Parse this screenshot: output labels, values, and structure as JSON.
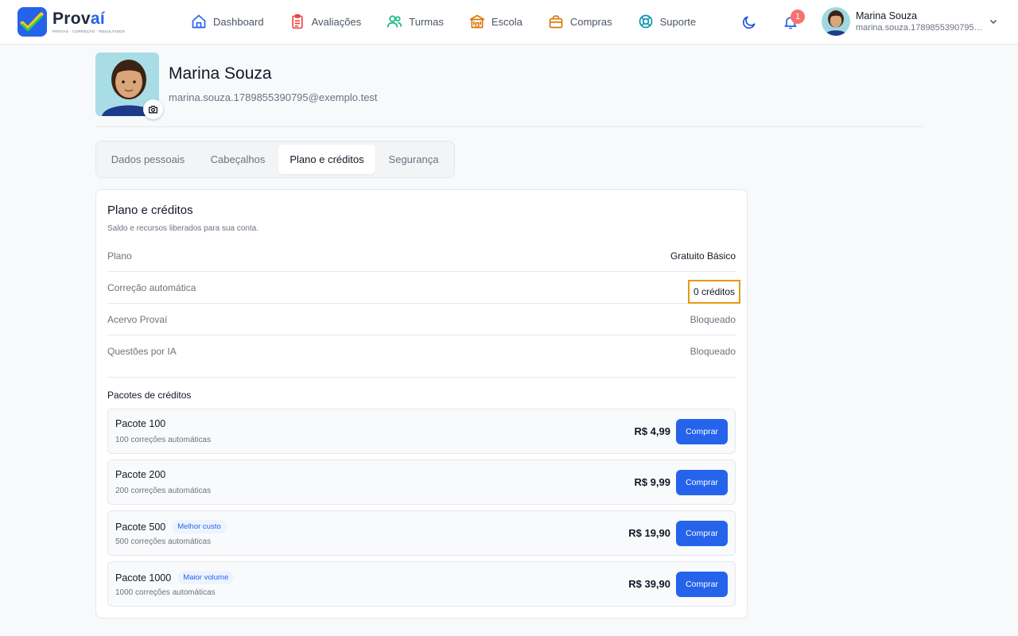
{
  "app": {
    "logo_prefix": "Prov",
    "logo_accent": "aí",
    "logo_tagline": "PROVAS · CORREÇÃO · RESULTADOS",
    "brand_color": "#2563eb"
  },
  "nav": {
    "items": [
      {
        "label": "Dashboard",
        "icon": "home-icon",
        "color": "#2563eb"
      },
      {
        "label": "Avaliações",
        "icon": "clipboard-icon",
        "color": "#ef4444"
      },
      {
        "label": "Turmas",
        "icon": "users-icon",
        "color": "#10b981"
      },
      {
        "label": "Escola",
        "icon": "school-icon",
        "color": "#d97706"
      },
      {
        "label": "Compras",
        "icon": "shopping-bag-icon",
        "color": "#d97706"
      },
      {
        "label": "Suporte",
        "icon": "lifebuoy-icon",
        "color": "#0891b2"
      }
    ],
    "notification_count": "1"
  },
  "user": {
    "name": "Marina Souza",
    "email": "marina.souza.1789855390795@exemplo.test"
  },
  "tabs": [
    {
      "label": "Dados pessoais",
      "active": false
    },
    {
      "label": "Cabeçalhos",
      "active": false
    },
    {
      "label": "Plano e créditos",
      "active": true
    },
    {
      "label": "Segurança",
      "active": false
    }
  ],
  "card": {
    "title": "Plano e créditos",
    "subtitle": "Saldo e recursos liberados para sua conta.",
    "rows": [
      {
        "label": "Plano",
        "value": "Gratuito Básico"
      },
      {
        "label": "Correção automática",
        "value": "0 créditos"
      },
      {
        "label": "Acervo Provaí",
        "value": "Bloqueado"
      },
      {
        "label": "Questões por IA",
        "value": "Bloqueado"
      }
    ],
    "packages_title": "Pacotes de créditos",
    "packages": [
      {
        "name": "Pacote 100",
        "tag": "",
        "desc": "100 correções automáticas",
        "price": "R$ 4,99",
        "button": "Comprar"
      },
      {
        "name": "Pacote 200",
        "tag": "",
        "desc": "200 correções automáticas",
        "price": "R$ 9,99",
        "button": "Comprar"
      },
      {
        "name": "Pacote 500",
        "tag": "Melhor custo",
        "desc": "500 correções automáticas",
        "price": "R$ 19,90",
        "button": "Comprar"
      },
      {
        "name": "Pacote 1000",
        "tag": "Maior volume",
        "desc": "1000 correções automáticas",
        "price": "R$ 39,90",
        "button": "Comprar"
      }
    ]
  }
}
